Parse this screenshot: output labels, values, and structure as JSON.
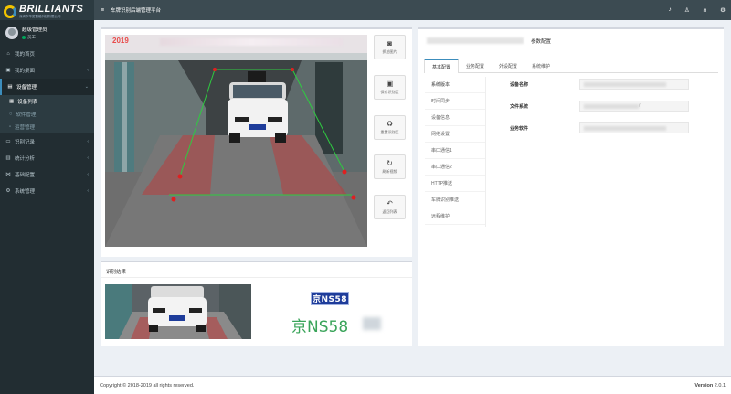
{
  "brand": {
    "name": "BRILLIANTS",
    "subtitle": "深圳市华夏智能科技有限公司"
  },
  "user": {
    "name": "超级管理员",
    "status": "员工"
  },
  "menu": [
    {
      "label": "我的首页",
      "icon": "home-icon"
    },
    {
      "label": "我的桌面",
      "icon": "desktop-icon"
    },
    {
      "label": "设备管理",
      "icon": "device-icon",
      "active": true,
      "children": [
        {
          "label": "设备列表",
          "active": true
        },
        {
          "label": "软件管理"
        },
        {
          "label": "运营管理"
        }
      ]
    },
    {
      "label": "识别记录",
      "icon": "record-icon"
    },
    {
      "label": "统计分析",
      "icon": "chart-icon"
    },
    {
      "label": "基础配置",
      "icon": "config-icon"
    },
    {
      "label": "系统管理",
      "icon": "system-icon"
    }
  ],
  "topbar": {
    "title": "车牌识别后端管理平台"
  },
  "video": {
    "year": "2019"
  },
  "toolbar": {
    "capture": "抓拍图片",
    "save_area": "保存识别区",
    "reset_area": "重置识别区",
    "refresh_video": "刷新视频",
    "back_list": "返回列表"
  },
  "result": {
    "title": "识别结果",
    "plate_small": "京NS58",
    "plate_large": "京NS58"
  },
  "config": {
    "header": "参数配置",
    "tabs": [
      "基本配置",
      "业务配置",
      "外设配置",
      "系统维护"
    ],
    "nav": [
      "系统版本",
      "时间同步",
      "设备信息",
      "网络设置",
      "串口通信1",
      "串口通信2",
      "HTTP推送",
      "车牌识别推送",
      "远程维护"
    ],
    "fields": [
      {
        "label": "设备名称"
      },
      {
        "label": "文件系统",
        "value": "/"
      },
      {
        "label": "业务软件"
      }
    ]
  },
  "footer": {
    "copyright": "Copyright © 2018-2019 all rights reserved.",
    "version_label": "Version",
    "version": "2.0.1"
  }
}
